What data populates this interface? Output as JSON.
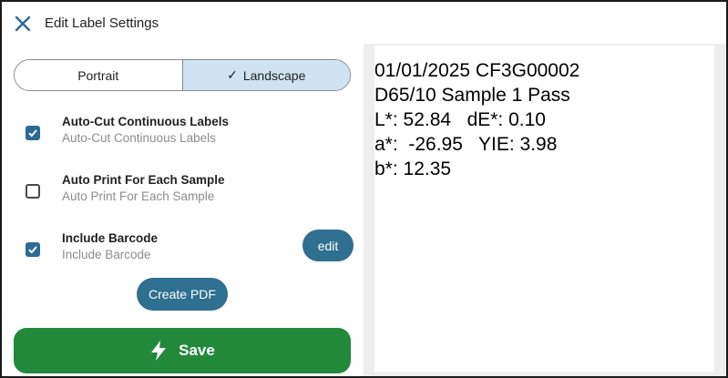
{
  "header": {
    "title": "Edit Label Settings",
    "close_icon": "close-icon"
  },
  "orientation": {
    "options": [
      "Portrait",
      "Landscape"
    ],
    "selected": "Landscape",
    "check_glyph": "✓"
  },
  "options": [
    {
      "label": "Auto-Cut Continuous Labels",
      "sublabel": "Auto-Cut Continuous Labels",
      "checked": true
    },
    {
      "label": "Auto Print For Each Sample",
      "sublabel": "Auto Print For Each Sample",
      "checked": false
    },
    {
      "label": "Include Barcode",
      "sublabel": "Include Barcode",
      "checked": true
    }
  ],
  "buttons": {
    "edit": "edit",
    "create_pdf": "Create PDF",
    "save": "Save"
  },
  "preview": {
    "lines": [
      "01/01/2025 CF3G00002",
      "D65/10 Sample 1 Pass",
      "L*: 52.84   dE*: 0.10",
      "a*:  -26.95   YIE: 3.98",
      "b*: 12.35"
    ]
  },
  "colors": {
    "accent": "#2f6f8f",
    "checkbox": "#2b6a95",
    "save": "#22893a",
    "segment_selected": "#cfe3f1"
  }
}
